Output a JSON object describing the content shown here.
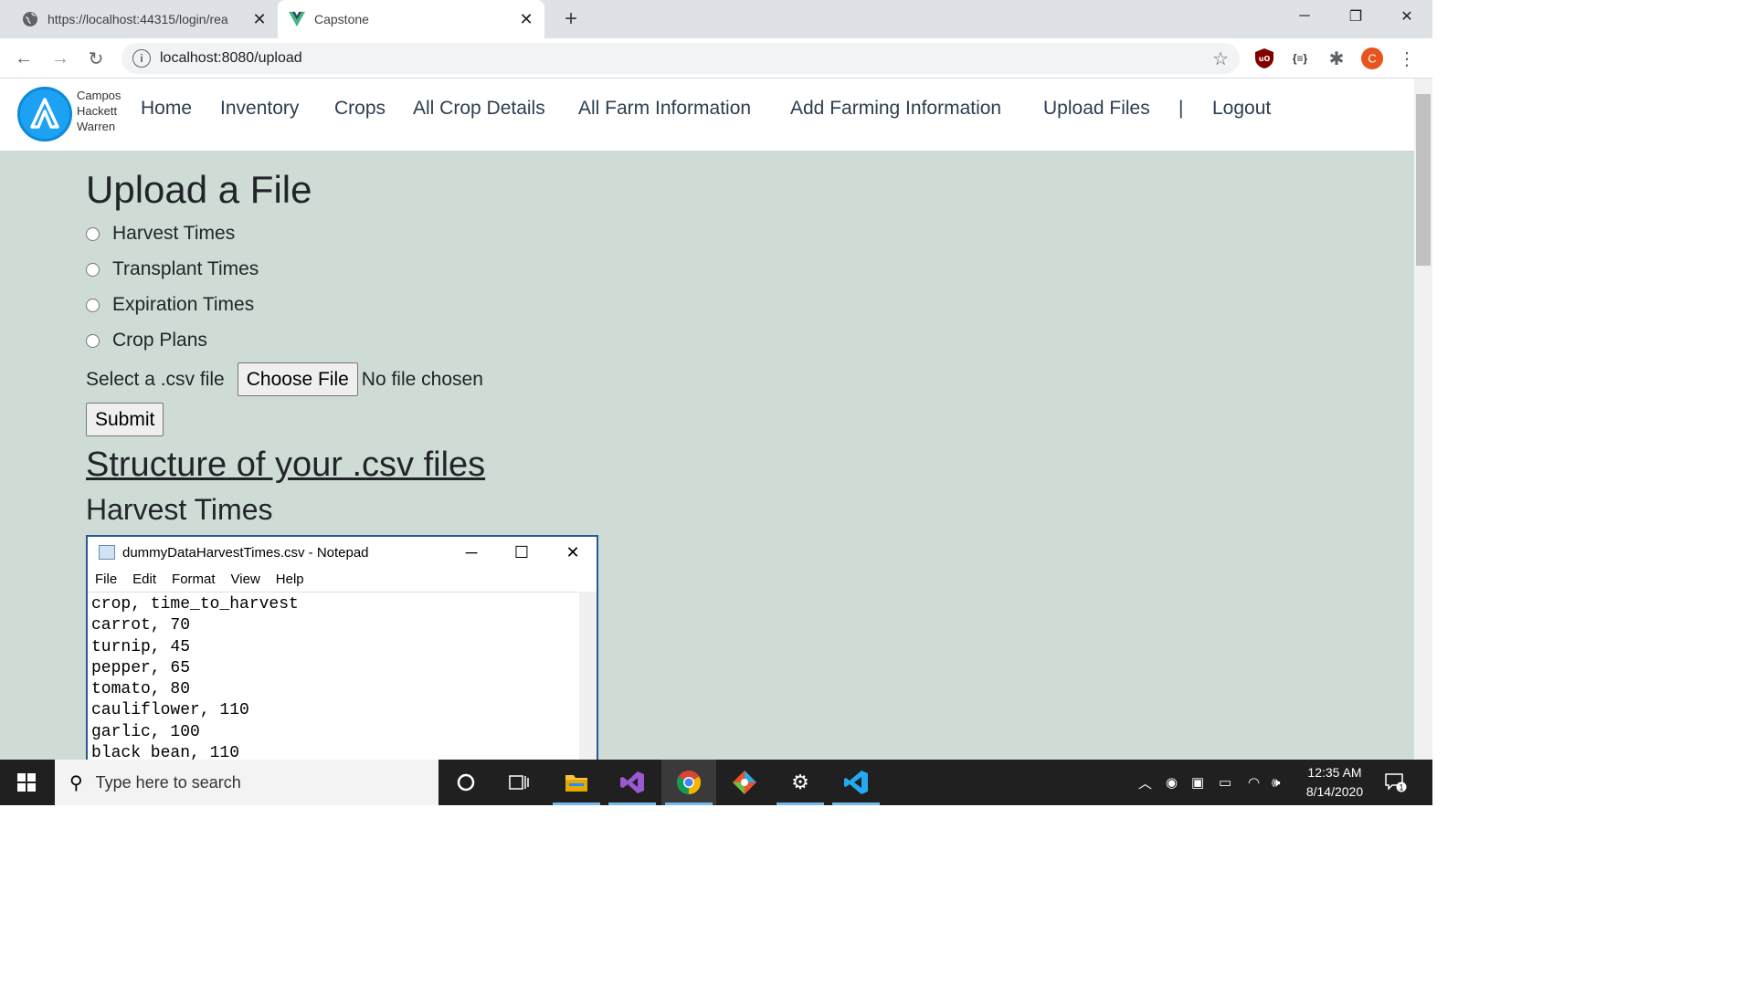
{
  "browser": {
    "tabs": [
      {
        "title": "https://localhost:44315/login/rea",
        "active": false
      },
      {
        "title": "Capstone",
        "active": true
      }
    ],
    "url": "localhost:8080/upload"
  },
  "navbar": {
    "brand_lines": [
      "Campos",
      "Hackett",
      "Warren"
    ],
    "items": [
      "Home",
      "Inventory",
      "Crops",
      "All Crop Details",
      "All Farm Information",
      "Add Farming Information",
      "Upload Files",
      "|",
      "Logout"
    ]
  },
  "upload": {
    "title": "Upload a File",
    "options": [
      "Harvest Times",
      "Transplant Times",
      "Expiration Times",
      "Crop Plans"
    ],
    "file_label": "Select a .csv file",
    "choose_button": "Choose File",
    "no_file": "No file chosen",
    "submit": "Submit"
  },
  "structure": {
    "link": "Structure of your .csv files",
    "section_title": "Harvest Times"
  },
  "notepad": {
    "title": "dummyDataHarvestTimes.csv - Notepad",
    "menu": [
      "File",
      "Edit",
      "Format",
      "View",
      "Help"
    ],
    "lines": [
      "crop, time_to_harvest",
      "carrot, 70",
      "turnip, 45",
      "pepper, 65",
      "tomato, 80",
      "cauliflower, 110",
      "garlic, 100",
      "black bean, 110"
    ]
  },
  "taskbar": {
    "search_placeholder": "Type here to search",
    "time": "12:35 AM",
    "date": "8/14/2020",
    "notification_count": "1"
  },
  "colors": {
    "page_bg": "#cfdcd5",
    "logo_blue": "#1da1f2",
    "nav_text": "#2c3e50"
  }
}
